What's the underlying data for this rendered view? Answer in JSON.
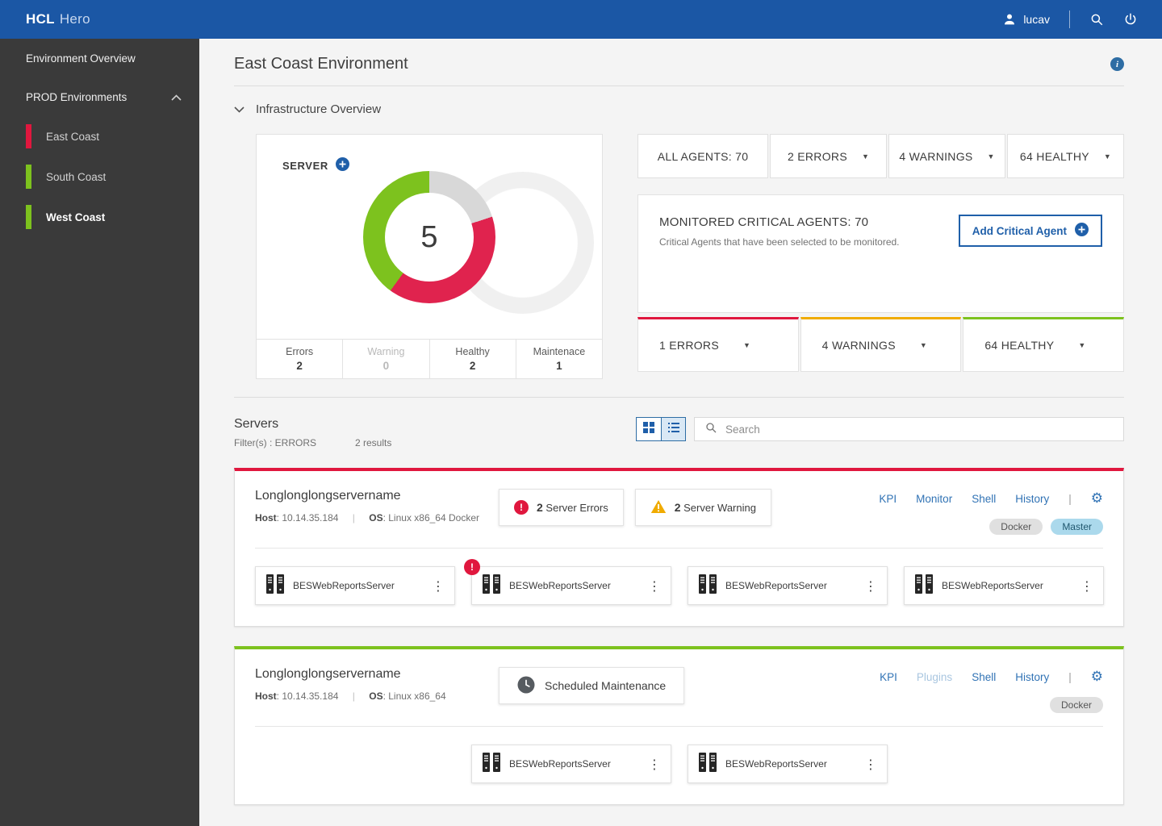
{
  "colors": {
    "topbar_blue": "#1b57a5",
    "sidebar_gray": "#3a3a3a",
    "error_red": "#e0173e",
    "warning_amber": "#f0ab00",
    "healthy_green": "#7dc21e",
    "maintenance_gray": "#d8d8d8",
    "link_blue": "#3173b5",
    "accent_blue": "#1f5fa9"
  },
  "topbar": {
    "brand": "HCL",
    "brand_suffix": "Hero",
    "user": "lucav"
  },
  "sidebar": {
    "overview_item": "Environment Overview",
    "group_item": "PROD Environments",
    "environments": [
      {
        "label": "East Coast"
      },
      {
        "label": "South Coast"
      },
      {
        "label": "West Coast"
      }
    ]
  },
  "page": {
    "title": "East Coast Environment"
  },
  "infrastructure": {
    "section_title": "Infrastructure Overview",
    "server_card": {
      "label": "SERVER",
      "total": "5",
      "legend": [
        {
          "label": "Errors",
          "value": "2"
        },
        {
          "label": "Warning",
          "value": "0"
        },
        {
          "label": "Healthy",
          "value": "2"
        },
        {
          "label": "Maintenace",
          "value": "1"
        }
      ]
    },
    "agent_filters": [
      {
        "label": "ALL AGENTS: 70"
      },
      {
        "label": "2 ERRORS"
      },
      {
        "label": "4 WARNINGS"
      },
      {
        "label": "64 HEALTHY"
      }
    ],
    "monitored": {
      "title": "MONITORED CRITICAL AGENTS: 70",
      "subtitle": "Critical Agents that have been selected to be monitored.",
      "add_button": "Add Critical Agent",
      "stats": [
        {
          "label": "1 ERRORS"
        },
        {
          "label": "4 WARNINGS"
        },
        {
          "label": "64 HEALTHY"
        }
      ]
    }
  },
  "servers": {
    "title": "Servers",
    "filter_text": "Filter(s) : ERRORS",
    "results_text": "2 results",
    "search_placeholder": "Search",
    "cards": [
      {
        "name": "Longlonglongservername",
        "host_label": "Host",
        "host_value": "10.14.35.184",
        "os_label": "OS",
        "os_value": "Linux x86_64 Docker",
        "status_chips": [
          {
            "count": "2",
            "label": "Server Errors",
            "type": "error"
          },
          {
            "count": "2",
            "label": "Server Warning",
            "type": "warning"
          }
        ],
        "actions": [
          "KPI",
          "Monitor",
          "Shell",
          "History"
        ],
        "tags": [
          "Docker",
          "Master"
        ],
        "agents": [
          {
            "name": "BESWebReportsServer",
            "error": false
          },
          {
            "name": "BESWebReportsServer",
            "error": true
          },
          {
            "name": "BESWebReportsServer",
            "error": false
          },
          {
            "name": "BESWebReportsServer",
            "error": false
          }
        ]
      },
      {
        "name": "Longlonglongservername",
        "host_label": "Host",
        "host_value": "10.14.35.184",
        "os_label": "OS",
        "os_value": "Linux x86_64",
        "maintenance_label": "Scheduled Maintenance",
        "actions": [
          "KPI",
          "Plugins",
          "Shell",
          "History"
        ],
        "tags": [
          "Docker"
        ],
        "agents": [
          {
            "name": "BESWebReportsServer",
            "error": false
          },
          {
            "name": "BESWebReportsServer",
            "error": false
          }
        ]
      }
    ]
  },
  "ui": {
    "pipe": "|"
  }
}
